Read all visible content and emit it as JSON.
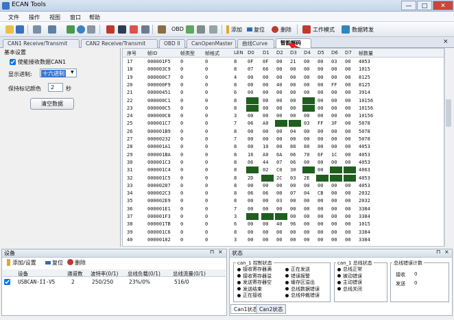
{
  "window": {
    "title": "ECAN Tools",
    "btn_min": "—",
    "btn_max": "□",
    "btn_close": "✕"
  },
  "menu": [
    "文件",
    "操作",
    "视图",
    "窗口",
    "帮助"
  ],
  "toolbar": {
    "add": "添加",
    "reset": "复位",
    "delete": "删除",
    "work_mode": "工作模式",
    "data_forward": "数据转发"
  },
  "tabs": [
    "CAN1 Receive/Transmit",
    "CAN2 Receive/Transmit",
    "OBD II",
    "CanOpenMaster",
    "曲线Curve",
    "智能解码"
  ],
  "active_tab": "智能解码",
  "tab_close": "×",
  "left": {
    "group_title": "基本设置",
    "enable_receive": "使能接收数据CAN1",
    "display_base_label": "显示进制:",
    "display_base_value": "十六进制",
    "dropdown_arrow": "▼",
    "keep_color_label": "保持标记颜色",
    "keep_color_value": "2",
    "keep_color_unit": "秒",
    "clear_button": "清空数据"
  },
  "grid": {
    "columns": [
      "序号",
      "帧ID",
      "帧类型",
      "帧格式",
      "LEN",
      "D0",
      "D1",
      "D2",
      "D3",
      "D4",
      "D5",
      "D6",
      "D7",
      "帧数量"
    ],
    "rows": [
      [
        "17",
        "000001F5",
        "0",
        "0",
        "8",
        "0F",
        "0F",
        "00",
        "21",
        "00",
        "00",
        "03",
        "00",
        "4053"
      ],
      [
        "18",
        "000003C9",
        "0",
        "0",
        "8",
        "07",
        "66",
        "00",
        "00",
        "00",
        "00",
        "00",
        "00",
        "1015"
      ],
      [
        "19",
        "000000C7",
        "0",
        "0",
        "4",
        "00",
        "00",
        "00",
        "00",
        "00",
        "00",
        "00",
        "00",
        "8125"
      ],
      [
        "20",
        "000000F9",
        "0",
        "0",
        "8",
        "00",
        "00",
        "40",
        "00",
        "00",
        "00",
        "FF",
        "00",
        "8125"
      ],
      [
        "21",
        "00000451",
        "0",
        "0",
        "6",
        "00",
        "00",
        "00",
        "00",
        "00",
        "00",
        "00",
        "00",
        "3914"
      ],
      [
        "22",
        "000000C1",
        "0",
        "0",
        "8",
        "",
        "00",
        "00",
        "00",
        "",
        "00",
        "00",
        "00",
        "10156"
      ],
      [
        "23",
        "000000C5",
        "0",
        "0",
        "8",
        "",
        "00",
        "00",
        "00",
        "",
        "00",
        "00",
        "00",
        "10156"
      ],
      [
        "24",
        "000000C8",
        "0",
        "0",
        "3",
        "00",
        "00",
        "00",
        "00",
        "00",
        "00",
        "00",
        "00",
        "10156"
      ],
      [
        "25",
        "000001C7",
        "0",
        "0",
        "7",
        "06",
        "A0",
        "",
        "",
        "03",
        "FF",
        "3F",
        "00",
        "5078"
      ],
      [
        "26",
        "000001B9",
        "0",
        "0",
        "8",
        "00",
        "00",
        "00",
        "04",
        "00",
        "00",
        "00",
        "00",
        "5078"
      ],
      [
        "27",
        "00000232",
        "0",
        "0",
        "7",
        "00",
        "00",
        "00",
        "00",
        "00",
        "00",
        "00",
        "00",
        "5078"
      ],
      [
        "28",
        "000001A1",
        "0",
        "0",
        "8",
        "00",
        "10",
        "00",
        "88",
        "80",
        "00",
        "00",
        "00",
        "4053"
      ],
      [
        "29",
        "000001BA",
        "0",
        "0",
        "8",
        "16",
        "A0",
        "6A",
        "06",
        "70",
        "6F",
        "1C",
        "00",
        "4053"
      ],
      [
        "30",
        "000001C3",
        "0",
        "0",
        "8",
        "06",
        "44",
        "07",
        "06",
        "00",
        "00",
        "00",
        "00",
        "4053"
      ],
      [
        "31",
        "000001C4",
        "0",
        "0",
        "8",
        "",
        "02",
        "C0",
        "30",
        "",
        "00",
        "",
        "",
        "4063"
      ],
      [
        "32",
        "000001C5",
        "0",
        "0",
        "8",
        "2D",
        "",
        "2C",
        "03",
        "2E",
        "",
        "",
        "",
        "4053"
      ],
      [
        "33",
        "00000287",
        "0",
        "0",
        "8",
        "00",
        "00",
        "00",
        "00",
        "00",
        "00",
        "00",
        "00",
        "4053"
      ],
      [
        "34",
        "000002C3",
        "0",
        "0",
        "8",
        "06",
        "06",
        "00",
        "07",
        "04",
        "CB",
        "00",
        "00",
        "2032"
      ],
      [
        "35",
        "000002E9",
        "0",
        "0",
        "8",
        "00",
        "00",
        "03",
        "00",
        "00",
        "00",
        "00",
        "00",
        "2032"
      ],
      [
        "36",
        "000001E1",
        "0",
        "0",
        "7",
        "00",
        "00",
        "00",
        "00",
        "00",
        "00",
        "00",
        "00",
        "3384"
      ],
      [
        "37",
        "000001F3",
        "0",
        "0",
        "3",
        "",
        "",
        "",
        "00",
        "00",
        "00",
        "00",
        "00",
        "3384"
      ],
      [
        "38",
        "000001TB",
        "0",
        "0",
        "6",
        "00",
        "00",
        "40",
        "96",
        "00",
        "00",
        "00",
        "00",
        "1015"
      ],
      [
        "39",
        "000001C6",
        "0",
        "0",
        "8",
        "00",
        "00",
        "00",
        "00",
        "00",
        "00",
        "00",
        "00",
        "3384"
      ],
      [
        "40",
        "00000182",
        "0",
        "0",
        "3",
        "00",
        "00",
        "00",
        "00",
        "00",
        "00",
        "00",
        "00",
        "3384"
      ]
    ]
  },
  "devices": {
    "title": "设备",
    "pin": "⊓",
    "close": "×",
    "add": "添加/设置",
    "reset": "复位",
    "delete": "删除",
    "columns": [
      "设备",
      "通道数",
      "波特率(0/1)",
      "总线负载(0/1)",
      "总线流量(0/1)"
    ],
    "rows": [
      [
        "USBCAN-II-V5",
        "2",
        "250/250",
        "23%/0%",
        "516/0"
      ]
    ]
  },
  "status": {
    "title": "状态",
    "pin": "⊓",
    "close": "×",
    "control_title": "can_1 控制状态",
    "control_items": [
      "接收寄存器满",
      "接收寄存器溢",
      "发送寄存器空",
      "发送结束",
      "正在接收"
    ],
    "control_items2": [
      "正在发送",
      "错误报警",
      "缓存区溢出",
      "总线数据错误",
      "总线仲裁错误"
    ],
    "bus_title": "can_1 总线状态",
    "bus_items": [
      "总线正常",
      "被动错误",
      "主动错误",
      "总线关闭"
    ],
    "err_title": "总线错误计数",
    "recv_label": "接收",
    "recv_value": "0",
    "send_label": "发送",
    "send_value": "0",
    "tabs": [
      "Can1状态",
      "Can2状态"
    ]
  }
}
